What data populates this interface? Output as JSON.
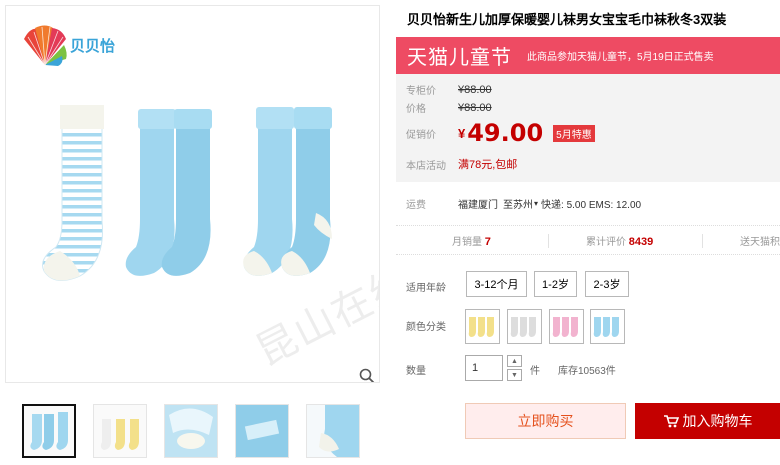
{
  "brand": {
    "name": "贝贝怡"
  },
  "product": {
    "title": "贝贝怡新生儿加厚保暖婴儿袜男女宝宝毛巾袜秋冬3双装"
  },
  "watermark": {
    "text": "昆山在线 KUNSHAN.BBS"
  },
  "promo": {
    "title": "天猫儿童节",
    "note": "此商品参加天猫儿童节，5月19日正式售卖"
  },
  "price": {
    "list_label": "专柜价",
    "list_value": "¥88.00",
    "orig_label": "价格",
    "orig_value": "¥88.00",
    "promo_label": "促销价",
    "currency": "¥",
    "promo_value": "49.00",
    "badge": "5月特惠",
    "shop_label": "本店活动",
    "shop_value": "满78元,包邮"
  },
  "shipping": {
    "label": "运费",
    "from": "福建厦门",
    "to": "至苏州",
    "fees": "快递: 5.00 EMS: 12.00"
  },
  "stats": {
    "monthly_label": "月销量",
    "monthly_value": "7",
    "reviews_label": "累计评价",
    "reviews_value": "8439",
    "points_label": "送天猫积"
  },
  "options": {
    "age_label": "适用年龄",
    "sizes": [
      "3-12个月",
      "1-2岁",
      "2-3岁"
    ],
    "color_label": "颜色分类",
    "colors": [
      "#f3e08a",
      "#dddddd",
      "#f2b3cf",
      "#9fd6ef"
    ]
  },
  "quantity": {
    "label": "数量",
    "value": "1",
    "unit": "件",
    "stock": "库存10563件"
  },
  "actions": {
    "buy": "立即购买",
    "cart": "加入购物车"
  },
  "thumbnails": [
    "blue-socks-set",
    "yellow-socks-set",
    "sock-detail-1",
    "sock-detail-2",
    "sock-detail-3"
  ],
  "colors": {
    "accent": "#c40000",
    "promo_bg": "#ee4b63",
    "sock_blue": "#9fd6ef"
  }
}
